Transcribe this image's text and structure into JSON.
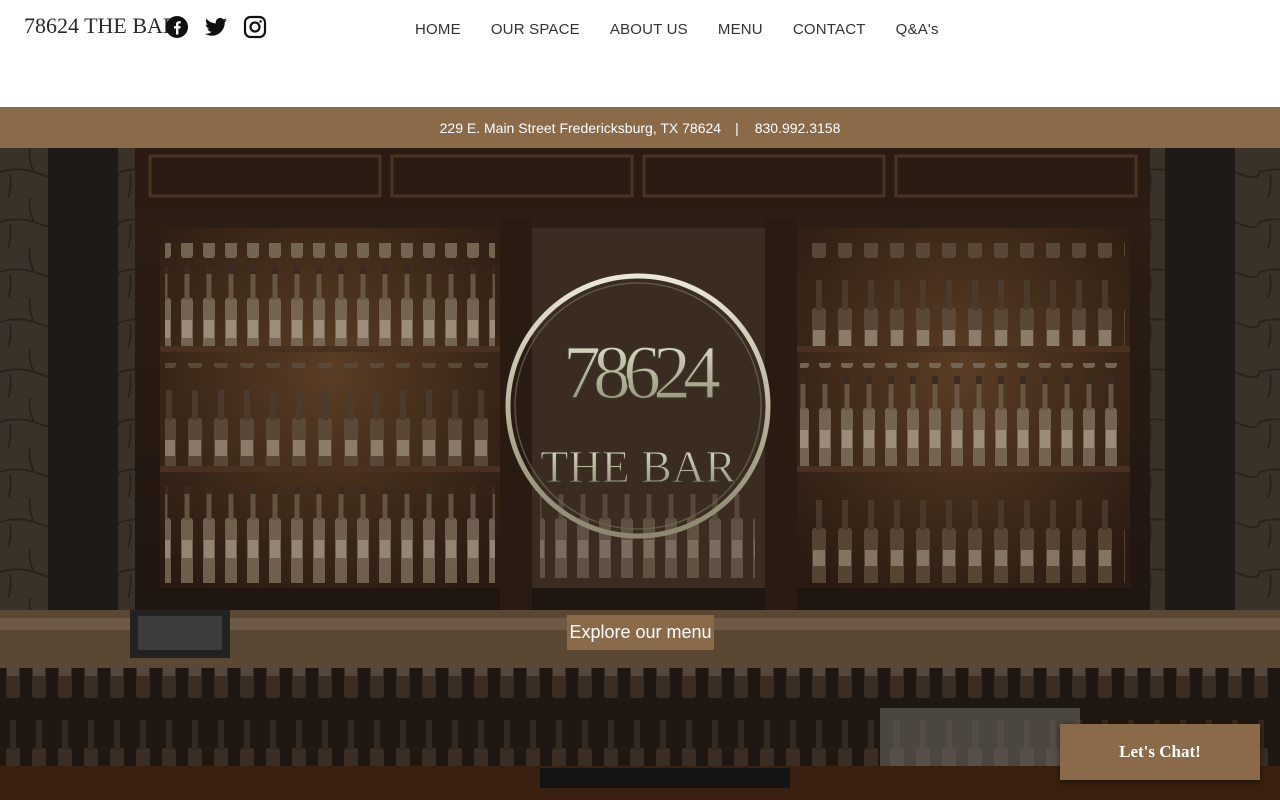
{
  "site": {
    "title": "78624 THE BAR"
  },
  "social": [
    {
      "name": "facebook-icon"
    },
    {
      "name": "twitter-icon"
    },
    {
      "name": "instagram-icon"
    }
  ],
  "nav": {
    "items": [
      {
        "label": "HOME"
      },
      {
        "label": "OUR SPACE"
      },
      {
        "label": "ABOUT US"
      },
      {
        "label": "MENU"
      },
      {
        "label": "CONTACT"
      },
      {
        "label": "Q&A's"
      }
    ]
  },
  "info": {
    "address": "229 E. Main Street Fredericksburg, TX 78624",
    "separator": "|",
    "phone": "830.992.3158"
  },
  "hero": {
    "logo": {
      "number": "78624",
      "name": "THE BAR"
    },
    "cta_label": "Explore our menu"
  },
  "chat": {
    "label": "Let's Chat!"
  },
  "colors": {
    "accent": "#8a6a48",
    "header_bg": "#ffffff",
    "text": "#333333"
  }
}
